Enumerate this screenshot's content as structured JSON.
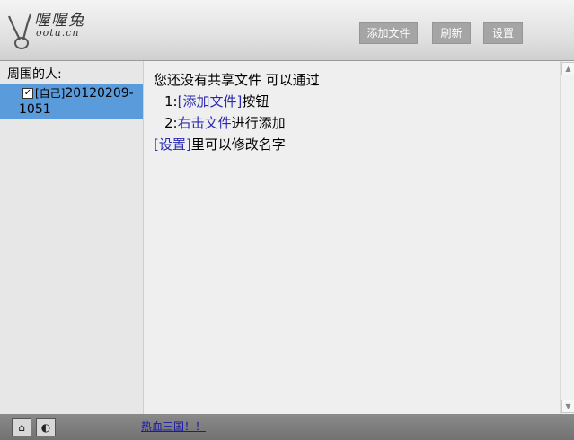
{
  "header": {
    "logo_text": "喔喔兔",
    "logo_domain": "ootu.cn",
    "add_file_label": "添加文件",
    "refresh_label": "刷新",
    "settings_label": "设置"
  },
  "sidebar": {
    "title": "周围的人:",
    "users": [
      {
        "tag": "[自己]",
        "name_part1": "20120209-",
        "name_part2": "1051",
        "checked": true
      }
    ]
  },
  "main": {
    "line1": "您还没有共享文件 可以通过",
    "line2_prefix": "1:",
    "line2_link": "[添加文件]",
    "line2_suffix": "按钮",
    "line3_prefix": "2:",
    "line3_link": "右击文件",
    "line3_suffix": "进行添加",
    "line4_link": "[设置]",
    "line4_suffix": "里可以修改名字"
  },
  "footer": {
    "link_text": "热血三国！！"
  }
}
